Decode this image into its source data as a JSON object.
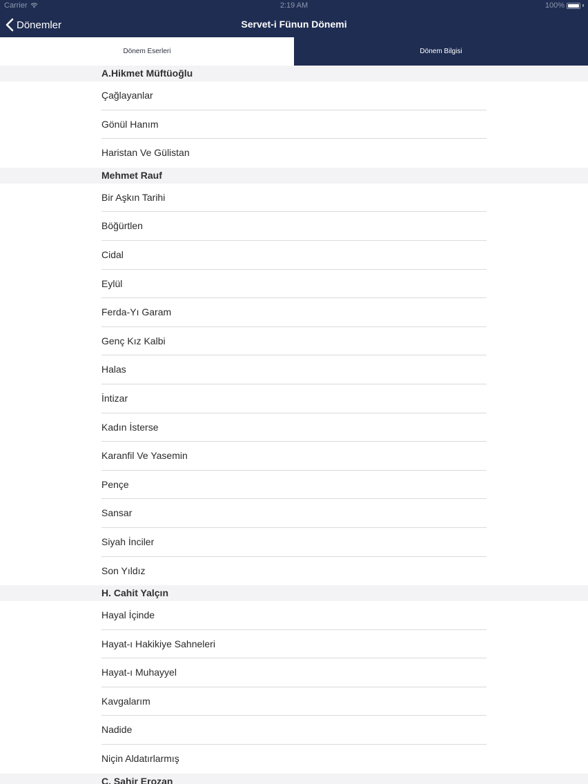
{
  "status_bar": {
    "carrier": "Carrier",
    "time": "2:19 AM",
    "battery": "100%",
    "wifi_icon": "wifi-icon",
    "battery_icon": "battery-icon"
  },
  "nav": {
    "back_label": "Dönemler",
    "back_icon": "chevron-left-icon",
    "title": "Servet-i Fünun Dönemi"
  },
  "tabs": [
    {
      "label": "Dönem Eserleri",
      "selected": true
    },
    {
      "label": "Dönem Bilgisi",
      "selected": false
    }
  ],
  "colors": {
    "nav_background": "#1f2d52",
    "section_background": "#f3f3f5",
    "divider": "#dadadd"
  },
  "sections": [
    {
      "author": "A.Hikmet Müftüoğlu",
      "items": [
        "Çağlayanlar",
        "Gönül Hanım",
        "Haristan Ve Gülistan"
      ]
    },
    {
      "author": "Mehmet Rauf",
      "items": [
        "Bir Aşkın Tarihi",
        "Böğürtlen",
        "Cidal",
        "Eylül",
        "Ferda-Yı Garam",
        "Genç Kız Kalbi",
        "Halas",
        "İntizar",
        "Kadın İsterse",
        "Karanfil Ve Yasemin",
        "Pençe",
        "Sansar",
        "Siyah İnciler",
        "Son Yıldız"
      ]
    },
    {
      "author": "H. Cahit Yalçın",
      "items": [
        "Hayal İçinde",
        "Hayat-ı Hakikiye Sahneleri",
        "Hayat-ı Muhayyel",
        "Kavgalarım",
        "Nadide",
        "Niçin Aldatırlarmış"
      ]
    },
    {
      "author": "C. Sahir Erozan",
      "items": []
    }
  ]
}
